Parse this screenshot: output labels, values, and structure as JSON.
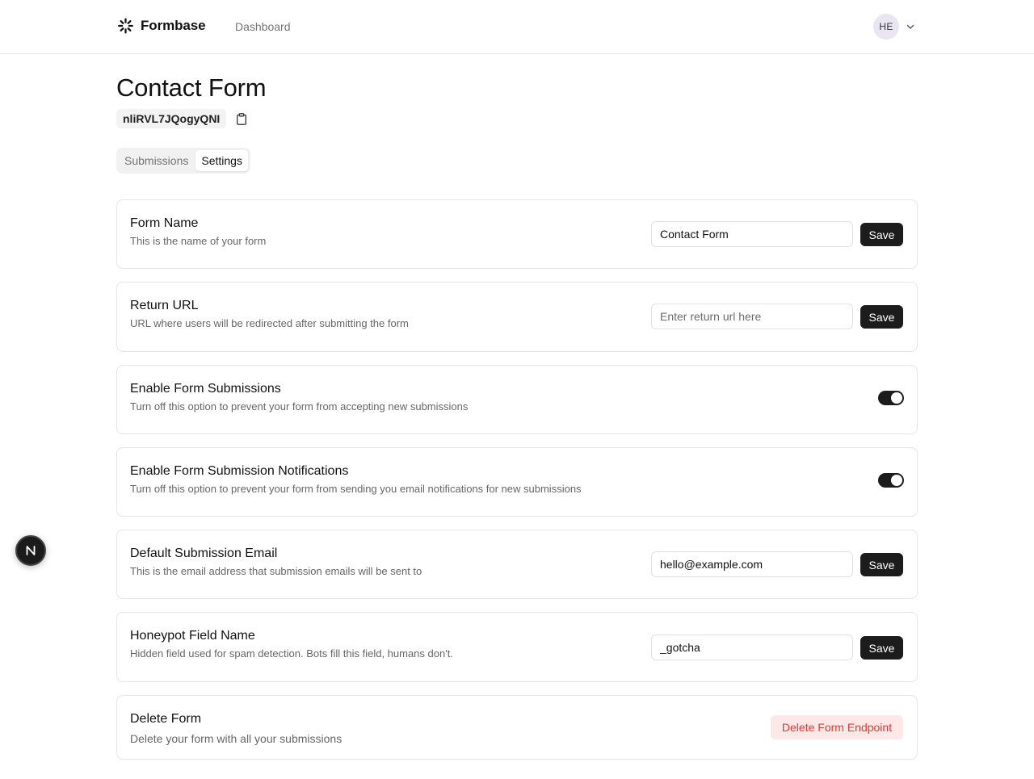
{
  "header": {
    "brand_name": "Formbase",
    "brand_icon": "spinner-logo-icon",
    "nav_dashboard": "Dashboard",
    "avatar_initials": "HE"
  },
  "page": {
    "title": "Contact Form",
    "form_id": "nliRVL7JQogyQNI"
  },
  "tabs": [
    {
      "label": "Submissions",
      "active": false
    },
    {
      "label": "Settings",
      "active": true
    }
  ],
  "settings": {
    "form_name": {
      "title": "Form Name",
      "description": "This is the name of your form",
      "value": "Contact Form",
      "save_label": "Save"
    },
    "return_url": {
      "title": "Return URL",
      "description": "URL where users will be redirected after submitting the form",
      "value": "",
      "placeholder": "Enter return url here",
      "save_label": "Save"
    },
    "enable_submissions": {
      "title": "Enable Form Submissions",
      "description": "Turn off this option to prevent your form from accepting new submissions",
      "enabled": true
    },
    "enable_notifications": {
      "title": "Enable Form Submission Notifications",
      "description": "Turn off this option to prevent your form from sending you email notifications for new submissions",
      "enabled": true
    },
    "default_email": {
      "title": "Default Submission Email",
      "description": "This is the email address that submission emails will be sent to",
      "value": "hello@example.com",
      "save_label": "Save"
    },
    "honeypot": {
      "title": "Honeypot Field Name",
      "description": "Hidden field used for spam detection. Bots fill this field, humans don't.",
      "value": "_gotcha",
      "save_label": "Save"
    },
    "delete_form": {
      "title": "Delete Form",
      "description": "Delete your form with all your submissions",
      "button_label": "Delete Form Endpoint"
    }
  },
  "dev_badge": {
    "letter": "N"
  },
  "colors": {
    "primary": "#1c1c1c",
    "danger_text": "#dc3a3a",
    "danger_bg": "#fde7e7",
    "muted_text": "#737373",
    "border": "#e5e5e5"
  }
}
